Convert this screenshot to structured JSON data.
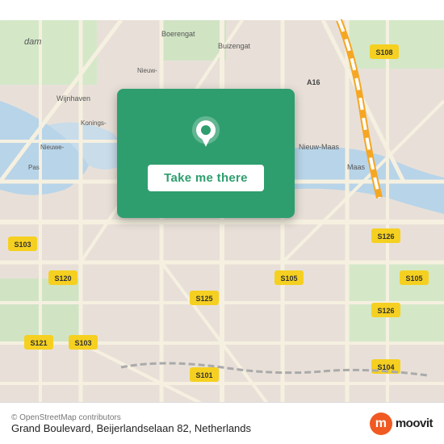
{
  "map": {
    "alt": "Street map of Rotterdam Netherlands area"
  },
  "card": {
    "button_label": "Take me there"
  },
  "bottom_bar": {
    "attribution": "© OpenStreetMap contributors",
    "address": "Grand Boulevard, Beijerlandselaan 82, Netherlands",
    "moovit_label": "moovit"
  }
}
